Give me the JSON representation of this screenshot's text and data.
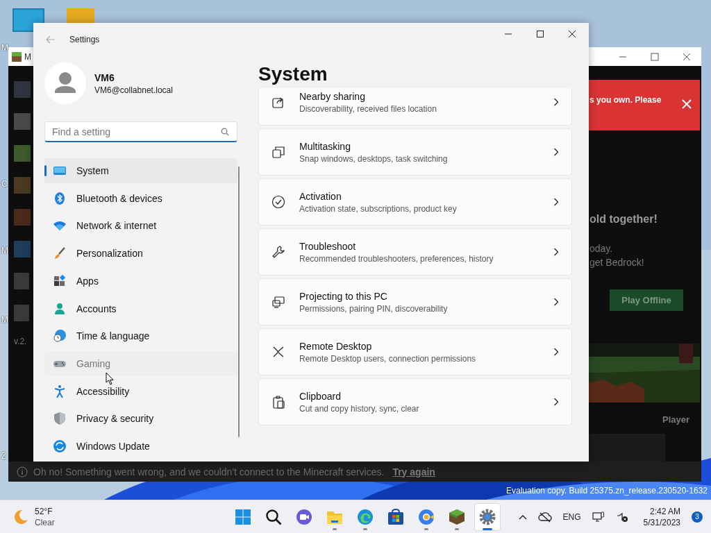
{
  "desktop": {
    "icon_labels": [
      "M",
      "C",
      "M",
      "M",
      "Z"
    ],
    "watermark": "Evaluation copy. Build 25375.zn_release.230520-1632"
  },
  "minecraft_window": {
    "title": "M",
    "banner": "s you own. Please",
    "headline": "old together!",
    "lines": [
      "oday.",
      "get Bedrock!"
    ],
    "play_button": "Play Offline",
    "player_label": "Player",
    "version": "v.2.",
    "error": "Oh no! Something went wrong, and we couldn't connect to the Minecraft services.",
    "error_link": "Try again"
  },
  "settings_window": {
    "title": "Settings",
    "user": {
      "name": "VM6",
      "email": "VM6@collabnet.local"
    },
    "search": {
      "placeholder": "Find a setting"
    },
    "nav": [
      {
        "label": "System",
        "kind": "system",
        "selected": true,
        "hovered": false
      },
      {
        "label": "Bluetooth & devices",
        "kind": "bluetooth",
        "selected": false,
        "hovered": false
      },
      {
        "label": "Network & internet",
        "kind": "wifi",
        "selected": false,
        "hovered": false
      },
      {
        "label": "Personalization",
        "kind": "brush",
        "selected": false,
        "hovered": false
      },
      {
        "label": "Apps",
        "kind": "apps",
        "selected": false,
        "hovered": false
      },
      {
        "label": "Accounts",
        "kind": "person",
        "selected": false,
        "hovered": false
      },
      {
        "label": "Time & language",
        "kind": "globe",
        "selected": false,
        "hovered": false
      },
      {
        "label": "Gaming",
        "kind": "gamepad",
        "selected": false,
        "hovered": true
      },
      {
        "label": "Accessibility",
        "kind": "accessibility",
        "selected": false,
        "hovered": false
      },
      {
        "label": "Privacy & security",
        "kind": "shield",
        "selected": false,
        "hovered": false
      },
      {
        "label": "Windows Update",
        "kind": "update",
        "selected": false,
        "hovered": false
      }
    ],
    "heading": "System",
    "cards": [
      {
        "title": "Nearby sharing",
        "subtitle": "Discoverability, received files location",
        "kind": "share"
      },
      {
        "title": "Multitasking",
        "subtitle": "Snap windows, desktops, task switching",
        "kind": "multitask"
      },
      {
        "title": "Activation",
        "subtitle": "Activation state, subscriptions, product key",
        "kind": "check"
      },
      {
        "title": "Troubleshoot",
        "subtitle": "Recommended troubleshooters, preferences, history",
        "kind": "wrench"
      },
      {
        "title": "Projecting to this PC",
        "subtitle": "Permissions, pairing PIN, discoverability",
        "kind": "project"
      },
      {
        "title": "Remote Desktop",
        "subtitle": "Remote Desktop users, connection permissions",
        "kind": "remote"
      },
      {
        "title": "Clipboard",
        "subtitle": "Cut and copy history, sync, clear",
        "kind": "clipboard"
      }
    ]
  },
  "taskbar": {
    "weather": {
      "temperature": "52°F",
      "condition": "Clear"
    },
    "apps": [
      {
        "kind": "start",
        "running": false,
        "selected": false
      },
      {
        "kind": "search",
        "running": false,
        "selected": false
      },
      {
        "kind": "chat",
        "running": false,
        "selected": false
      },
      {
        "kind": "explorer",
        "running": true,
        "selected": false
      },
      {
        "kind": "edge",
        "running": true,
        "selected": false
      },
      {
        "kind": "store",
        "running": false,
        "selected": false
      },
      {
        "kind": "chrome",
        "running": true,
        "selected": false
      },
      {
        "kind": "minecraft",
        "running": true,
        "selected": false
      },
      {
        "kind": "settings",
        "running": true,
        "selected": true
      }
    ],
    "language": "ENG",
    "time": "2:42 AM",
    "date": "5/31/2023",
    "notifications": "3"
  }
}
